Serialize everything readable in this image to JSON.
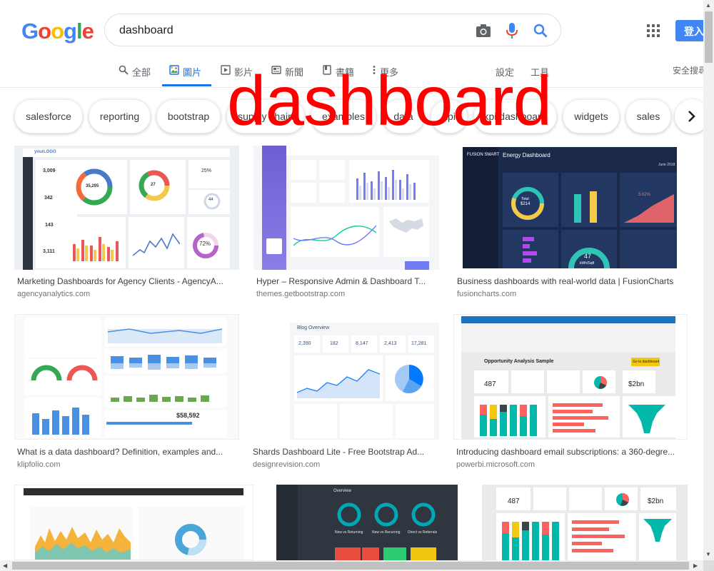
{
  "logo": {
    "letters": [
      "G",
      "o",
      "o",
      "g",
      "l",
      "e"
    ],
    "colors": [
      "#4285f4",
      "#ea4335",
      "#fbbc05",
      "#4285f4",
      "#34a853",
      "#ea4335"
    ]
  },
  "search": {
    "value": "dashboard",
    "camera_icon": "camera-icon",
    "mic_icon": "mic-icon",
    "search_icon": "search-icon"
  },
  "header": {
    "signin_label": "登入",
    "apps_icon": "apps-grid-icon"
  },
  "tabs": [
    {
      "label": "全部",
      "icon": "search-icon",
      "active": false
    },
    {
      "label": "圖片",
      "icon": "image-icon",
      "active": true
    },
    {
      "label": "影片",
      "icon": "video-icon",
      "active": false
    },
    {
      "label": "新聞",
      "icon": "news-icon",
      "active": false
    },
    {
      "label": "書籍",
      "icon": "book-icon",
      "active": false
    },
    {
      "label": "更多",
      "icon": "more-vert-icon",
      "active": false
    }
  ],
  "tools": {
    "settings": "設定",
    "tools": "工具",
    "safe_search": "安全搜尋"
  },
  "overlay": {
    "text": "dashboard",
    "color": "#ff0000"
  },
  "chips": [
    "salesforce",
    "reporting",
    "bootstrap",
    "supply chain",
    "examples",
    "data",
    "kpi",
    "kpi dashboard",
    "widgets",
    "sales"
  ],
  "results": [
    {
      "title": "Marketing Dashboards for Agency Clients - AgencyA...",
      "source": "agencyanalytics.com"
    },
    {
      "title": "Hyper – Responsive Admin & Dashboard T...",
      "source": "themes.getbootstrap.com"
    },
    {
      "title": "Business dashboards with real-world data | FusionCharts",
      "source": "fusioncharts.com"
    },
    {
      "title": "What is a data dashboard? Definition, examples and...",
      "source": "klipfolio.com"
    },
    {
      "title": "Shards Dashboard Lite - Free Bootstrap Ad...",
      "source": "designrevision.com"
    },
    {
      "title": "Introducing dashboard email subscriptions: a 360-degre...",
      "source": "powerbi.microsoft.com"
    },
    {
      "title": "",
      "source": ""
    },
    {
      "title": "",
      "source": ""
    },
    {
      "title": "",
      "source": ""
    }
  ],
  "thumb_text": {
    "agency": {
      "logo": "yourLOGO",
      "n1": "3,009",
      "n2": "342",
      "n3": "143",
      "n4": "3,111",
      "donut1": "35,295",
      "donut2": "27",
      "pct": "25%",
      "small": "44",
      "ring": "72%"
    },
    "fusion": {
      "brand": "FUSION SMART",
      "title": "Energy Dashboard",
      "date": "June 2018",
      "total": "Total",
      "total_val": "$214",
      "pct": "5.62%",
      "gauge": "47",
      "gauge_unit": "kWh/Sqft"
    },
    "klip": {
      "val1": "$58,592"
    },
    "shards": {
      "title": "Blog Overview",
      "s1": "2,390",
      "s2": "182",
      "s3": "8,147",
      "s4": "2,413",
      "s5": "17,281"
    },
    "powerbi": {
      "title": "Opportunity Analysis Sample",
      "v1": "487",
      "v2": "$2bn",
      "btn": "Go to dashboard"
    },
    "geckoboard": {
      "title": "Overview",
      "m1": "New vs Returning",
      "m2": "New vs Recurring",
      "m3": "Direct vs Referrals"
    }
  }
}
